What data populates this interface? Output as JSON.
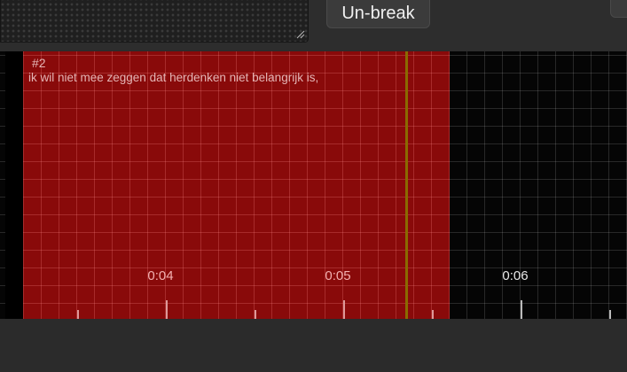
{
  "toolbar": {
    "unbreak_label": "Un-break"
  },
  "timeline": {
    "region": {
      "index": "#2",
      "text": "ik wil niet mee zeggen dat herdenken niet belangrijk is,",
      "color": "#a00c0c"
    },
    "time_labels": [
      "0:04",
      "0:05",
      "0:06"
    ],
    "playhead_color": "#8a6a00"
  }
}
